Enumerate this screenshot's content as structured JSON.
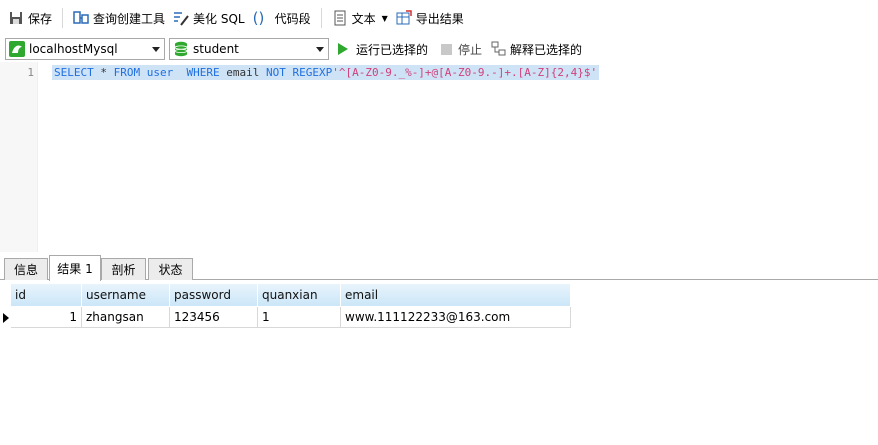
{
  "toolbar": {
    "save": "保存",
    "query_builder": "查询创建工具",
    "beautify_sql": "美化 SQL",
    "code_snippet": "代码段",
    "text": "文本",
    "export_result": "导出结果"
  },
  "connection": {
    "connection_value": "localhostMysql",
    "database_value": "student",
    "run_selected": "运行已选择的",
    "stop": "停止",
    "explain_selected": "解释已选择的"
  },
  "editor": {
    "line_number": "1",
    "sql": {
      "kw1": "SELECT",
      "t1": " * ",
      "kw2": "FROM",
      "t2": " ",
      "kw3": "user",
      "t3": "  ",
      "kw4": "WHERE",
      "t4": " email ",
      "kw5": "NOT REGEXP",
      "str": "'^[A-Z0-9._%-]+@[A-Z0-9.-]+.[A-Z]{2,4}$'"
    }
  },
  "tabs": [
    "信息",
    "结果 1",
    "剖析",
    "状态"
  ],
  "result": {
    "columns": [
      "id",
      "username",
      "password",
      "quanxian",
      "email"
    ],
    "rows": [
      [
        "1",
        "zhangsan",
        "123456",
        "1",
        "www.111122233@163.com"
      ]
    ]
  },
  "colors": {
    "keyword": "#1f6fe0",
    "string": "#d0407a",
    "selection": "#cfe3f7",
    "header": "#cbe6f8",
    "run_green": "#2ea82e"
  }
}
